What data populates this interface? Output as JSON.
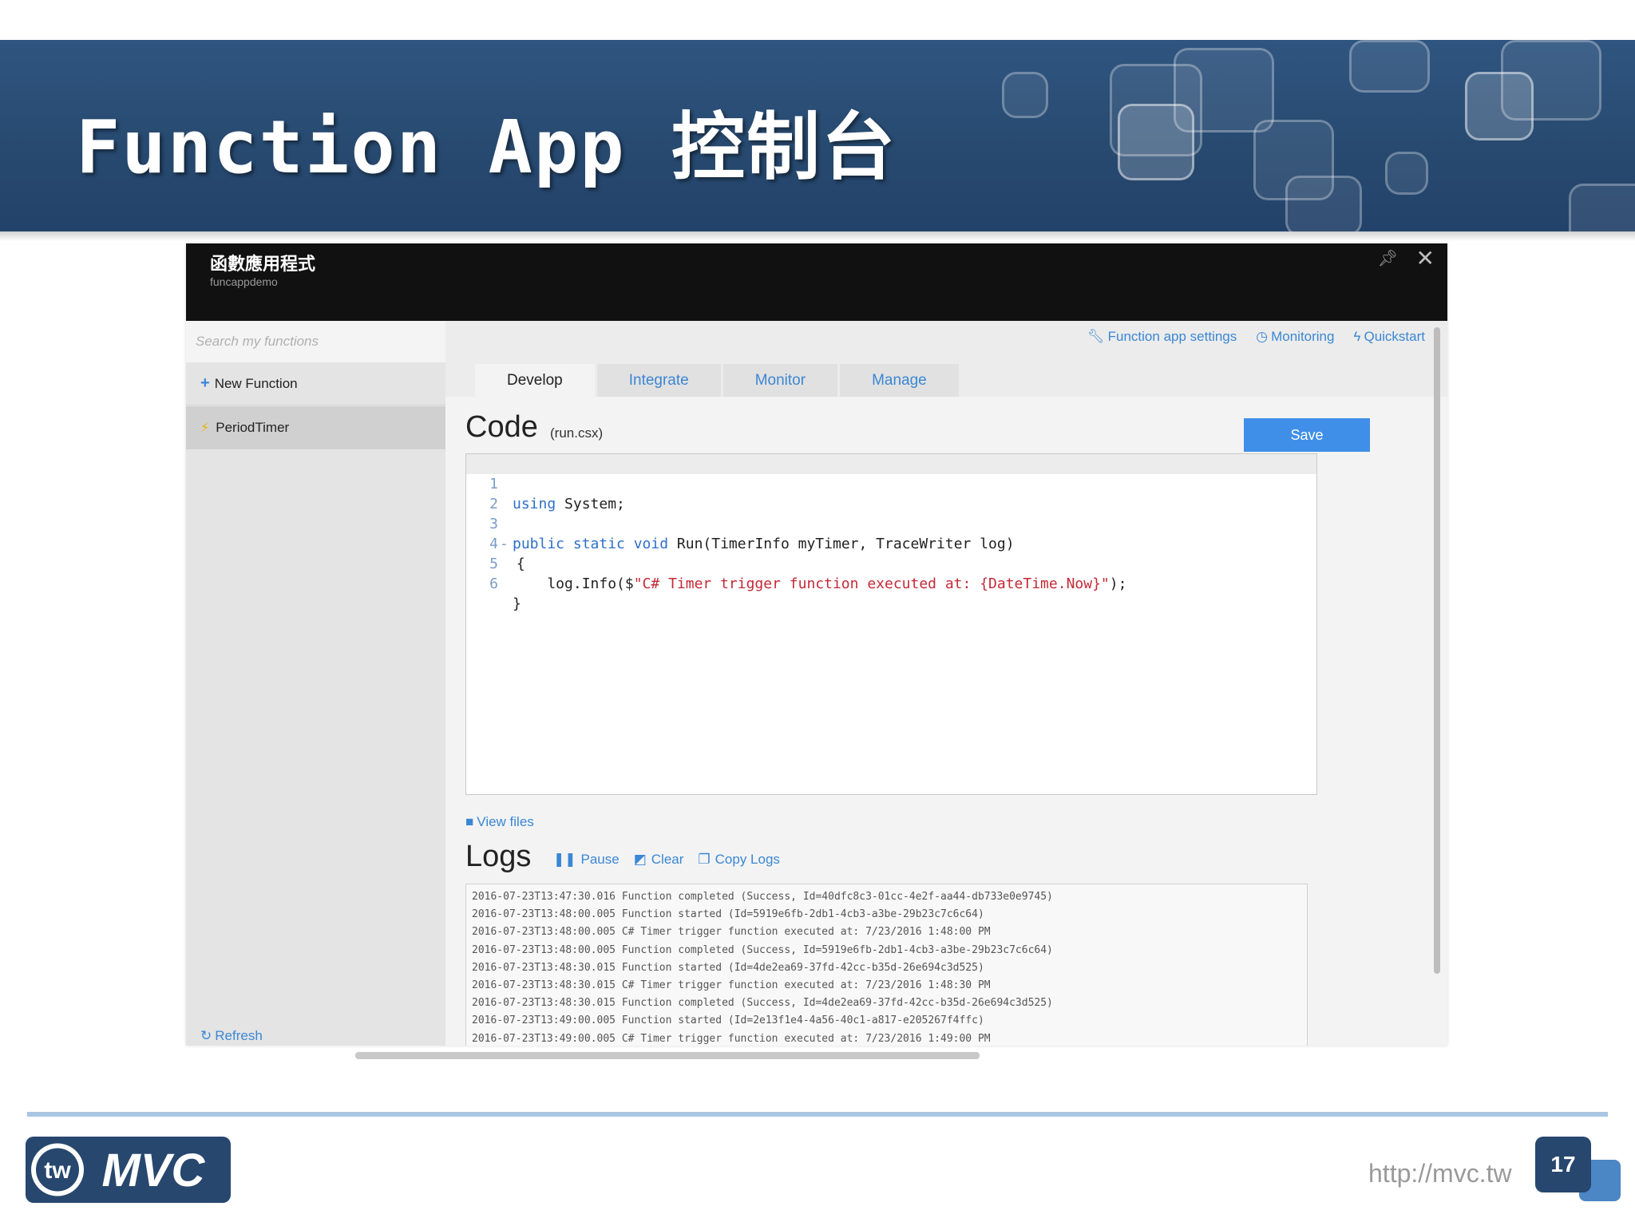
{
  "slide": {
    "title": "Function App 控制台",
    "url": "http://mvc.tw",
    "page_number": "17",
    "logo_text": "MVC",
    "logo_badge": "tw",
    "colors": {
      "banner": "#2f5580",
      "accent": "#3b87d4",
      "save": "#3f8fe8"
    }
  },
  "window": {
    "title": "函數應用程式",
    "subtitle": "funcappdemo",
    "pin_icon": "pin-icon",
    "close_icon": "close-icon"
  },
  "sidebar": {
    "search_placeholder": "Search my functions",
    "new_function_label": "New Function",
    "functions": [
      {
        "name": "PeriodTimer"
      }
    ],
    "refresh_label": "Refresh"
  },
  "toplinks": {
    "settings": "Function app settings",
    "monitoring": "Monitoring",
    "quickstart": "Quickstart"
  },
  "tabs": [
    {
      "label": "Develop",
      "active": true
    },
    {
      "label": "Integrate",
      "active": false
    },
    {
      "label": "Monitor",
      "active": false
    },
    {
      "label": "Manage",
      "active": false
    }
  ],
  "code": {
    "heading": "Code",
    "file": "(run.csx)",
    "save_label": "Save",
    "lines": [
      {
        "num": "1"
      },
      {
        "num": "2"
      },
      {
        "num": "3"
      },
      {
        "num": "4"
      },
      {
        "num": "5"
      },
      {
        "num": "6"
      }
    ],
    "line1": {
      "kw": "using",
      "rest": " System;"
    },
    "line3": {
      "kw": "public static void",
      "rest": " Run(TimerInfo myTimer, TraceWriter log)"
    },
    "line4": {
      "fold": "-",
      "text": " {"
    },
    "line5": {
      "pre": "    log.Info($",
      "str": "\"C# Timer trigger function executed at: {DateTime.Now}\"",
      "post": ");"
    },
    "line6": {
      "text": "}"
    }
  },
  "view_files_label": "View files",
  "logs": {
    "heading": "Logs",
    "pause_label": "Pause",
    "clear_label": "Clear",
    "copy_label": "Copy Logs",
    "lines": [
      "2016-07-23T13:47:30.016 Function completed (Success, Id=40dfc8c3-01cc-4e2f-aa44-db733e0e9745)",
      "2016-07-23T13:48:00.005 Function started (Id=5919e6fb-2db1-4cb3-a3be-29b23c7c6c64)",
      "2016-07-23T13:48:00.005 C# Timer trigger function executed at: 7/23/2016 1:48:00 PM",
      "2016-07-23T13:48:00.005 Function completed (Success, Id=5919e6fb-2db1-4cb3-a3be-29b23c7c6c64)",
      "2016-07-23T13:48:30.015 Function started (Id=4de2ea69-37fd-42cc-b35d-26e694c3d525)",
      "2016-07-23T13:48:30.015 C# Timer trigger function executed at: 7/23/2016 1:48:30 PM",
      "2016-07-23T13:48:30.015 Function completed (Success, Id=4de2ea69-37fd-42cc-b35d-26e694c3d525)",
      "2016-07-23T13:49:00.005 Function started (Id=2e13f1e4-4a56-40c1-a817-e205267f4ffc)",
      "2016-07-23T13:49:00.005 C# Timer trigger function executed at: 7/23/2016 1:49:00 PM"
    ]
  }
}
